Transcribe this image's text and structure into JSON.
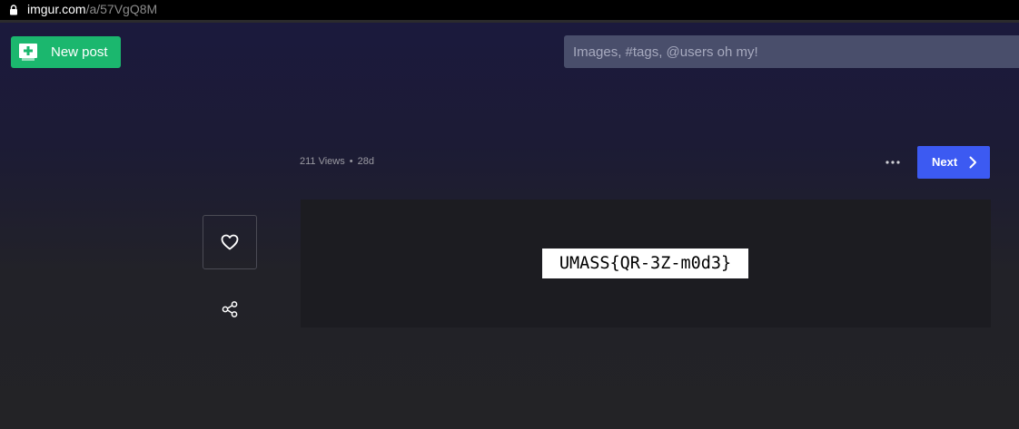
{
  "browser": {
    "url_domain": "imgur.com",
    "url_path": "/a/57VgQ8M",
    "lock_icon": "lock-icon"
  },
  "header": {
    "new_post_label": "New post",
    "new_post_icon": "plus-square-icon",
    "search_placeholder": "Images, #tags, @users oh my!"
  },
  "post": {
    "views": "211 Views",
    "separator": "•",
    "age": "28d",
    "more_icon": "ellipsis-icon",
    "next_label": "Next",
    "next_icon": "chevron-right-icon",
    "like_icon": "heart-icon",
    "share_icon": "share-icon",
    "image_text": "UMASS{QR-3Z-m0d3}"
  },
  "colors": {
    "accent_green": "#1bb76e",
    "accent_blue": "#3c5af2",
    "search_bg": "#494e6b",
    "page_top": "#1b1a3d",
    "page_bottom": "#232326"
  }
}
